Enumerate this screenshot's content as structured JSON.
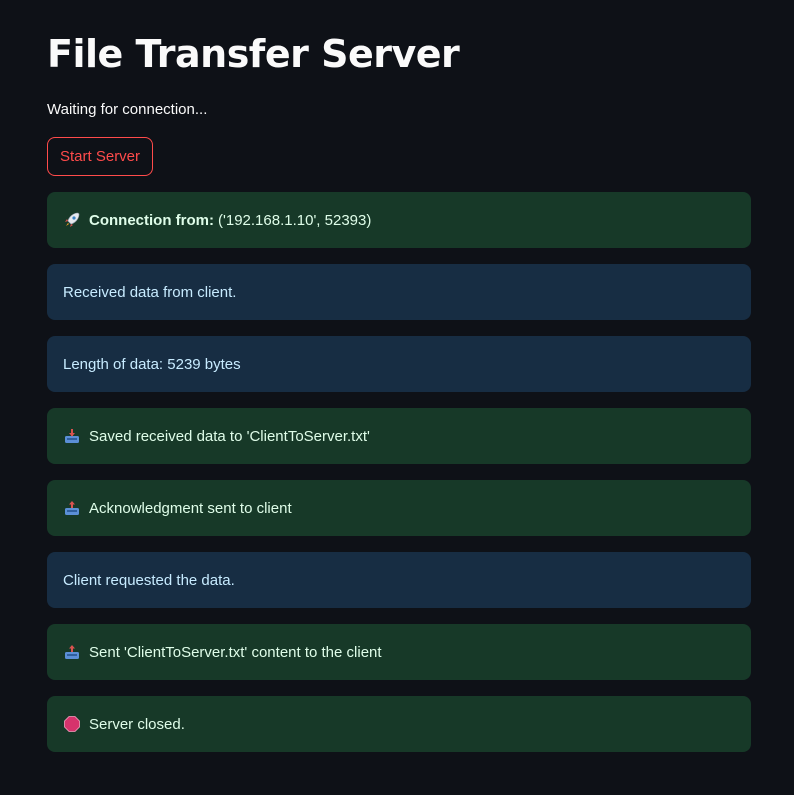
{
  "page": {
    "title": "File Transfer Server",
    "status_text": "Waiting for connection...",
    "start_button_label": "Start Server"
  },
  "messages": [
    {
      "type": "success",
      "icon": "rocket-icon",
      "bold": "Connection from:",
      "text": "('192.168.1.10', 52393)"
    },
    {
      "type": "info",
      "text": "Received data from client."
    },
    {
      "type": "info",
      "text": "Length of data: 5239 bytes"
    },
    {
      "type": "success",
      "icon": "inbox-tray-icon",
      "text": "Saved received data to 'ClientToServer.txt'"
    },
    {
      "type": "success",
      "icon": "outbox-tray-icon",
      "text": "Acknowledgment sent to client"
    },
    {
      "type": "info",
      "text": "Client requested the data."
    },
    {
      "type": "success",
      "icon": "outbox-tray-icon",
      "text": "Sent 'ClientToServer.txt' content to the client"
    },
    {
      "type": "success",
      "icon": "stop-sign-icon",
      "text": "Server closed."
    }
  ],
  "colors": {
    "background": "#0e1117",
    "accent": "#ff4b4b",
    "success_bg": "#173928",
    "success_text": "#dffde9",
    "info_bg": "#172d43",
    "info_text": "#c7ebff"
  }
}
